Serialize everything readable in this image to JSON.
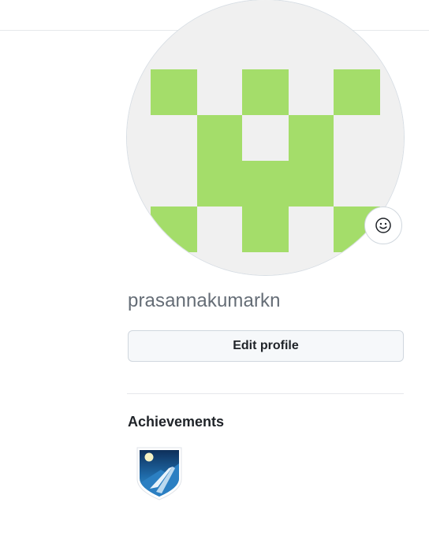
{
  "profile": {
    "username": "prasannakumarkn",
    "edit_profile_label": "Edit profile",
    "avatar_color": "#a4dd6a",
    "avatar_background": "#f0f0f0"
  },
  "set_status_icon": "smiley-icon",
  "achievements": {
    "title": "Achievements",
    "badges": [
      {
        "icon": "achievement-badge-icon"
      }
    ]
  }
}
